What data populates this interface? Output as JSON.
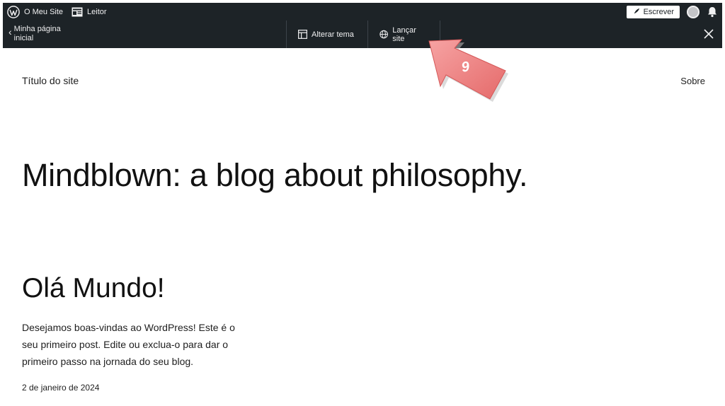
{
  "adminbar": {
    "site_name": "O Meu Site",
    "reader_label": "Leitor",
    "write_label": "Escrever"
  },
  "navbar": {
    "back_label": "Minha página inicial",
    "change_theme_label": "Alterar tema",
    "launch_site_label": "Lançar site"
  },
  "site": {
    "title": "Título do site",
    "nav_about": "Sobre",
    "tagline": "Mindblown: a blog about philosophy."
  },
  "post": {
    "title": "Olá Mundo!",
    "excerpt": "Desejamos boas-vindas ao WordPress! Este é o seu primeiro post. Edite ou exclua-o para dar o primeiro passo na jornada do seu blog.",
    "date": "2 de janeiro de 2024"
  },
  "annotation": {
    "step_number": "9",
    "arrow_color": "#f08a8a"
  },
  "colors": {
    "bar_bg": "#1d2327",
    "bar_text": "#f0f0f1"
  },
  "icons": [
    "wordpress-logo-icon",
    "reader-icon",
    "pen-icon",
    "avatar",
    "bell-icon",
    "chevron-left-icon",
    "layout-icon",
    "globe-icon",
    "close-icon"
  ]
}
